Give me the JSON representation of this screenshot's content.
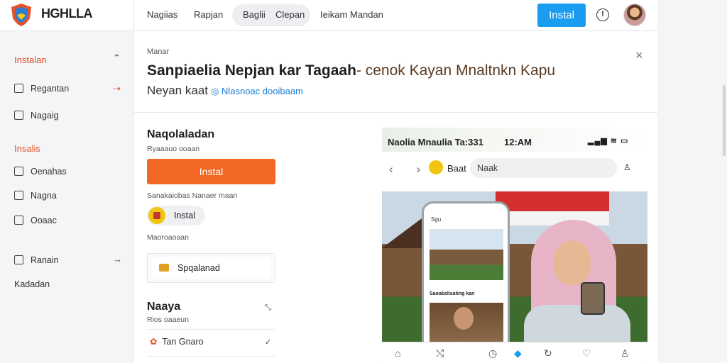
{
  "app": {
    "brand": "HGHLLA",
    "brand_sub": ""
  },
  "header": {
    "nav": [
      "Nagiias",
      "Rapjan",
      "Baglii",
      "Clepan",
      "Ieikam Mandan"
    ],
    "install_label": "Instal",
    "help_label": "!"
  },
  "sidebar": {
    "section1": "Instalan",
    "items1": [
      "Regantan",
      "Nagaig"
    ],
    "section2": "Insalis",
    "items2": [
      "Oenahas",
      "Nagna",
      "Ooaac"
    ],
    "items3": [
      "Ranain"
    ],
    "footer": "Kadadan"
  },
  "main": {
    "breadcrumb": "Manar",
    "title_bold": "Sanpiaelia Nepjan kar Tagaah",
    "title_rest": "- cenok Kayan Mnaltnkn Kapu",
    "subtitle": "Neyan kaat",
    "subtitle_link": "Nlasnoac dooibaam",
    "close_label": "×",
    "section_title": "Naqolaladan",
    "section_sub": "Ryaaauo ooaan",
    "install_label": "Instal",
    "note1": "Sanakaiobas Nanaer maan",
    "chip_label": "Instal",
    "note2": "Maoroaoaan",
    "field_label": "Spqalanad",
    "section2_title": "Naaya",
    "section2_sub": "Rios oaaeun",
    "rows": [
      {
        "label": "Tan Gnaro",
        "icon": "✓"
      }
    ]
  },
  "preview": {
    "status_left": "Naolia Mnaulia Ta:331",
    "status_time": "12:AM",
    "status_icons": "▂▄▆ ≋ ▭",
    "page_name": "Baat",
    "search": "Naak",
    "mini_header": "Sgu",
    "mini_caption": "Saoabslisating kan"
  },
  "colors": {
    "accent": "#f26722",
    "install_blue": "#1a9cf0",
    "sidebar_heading": "#e2522b"
  }
}
